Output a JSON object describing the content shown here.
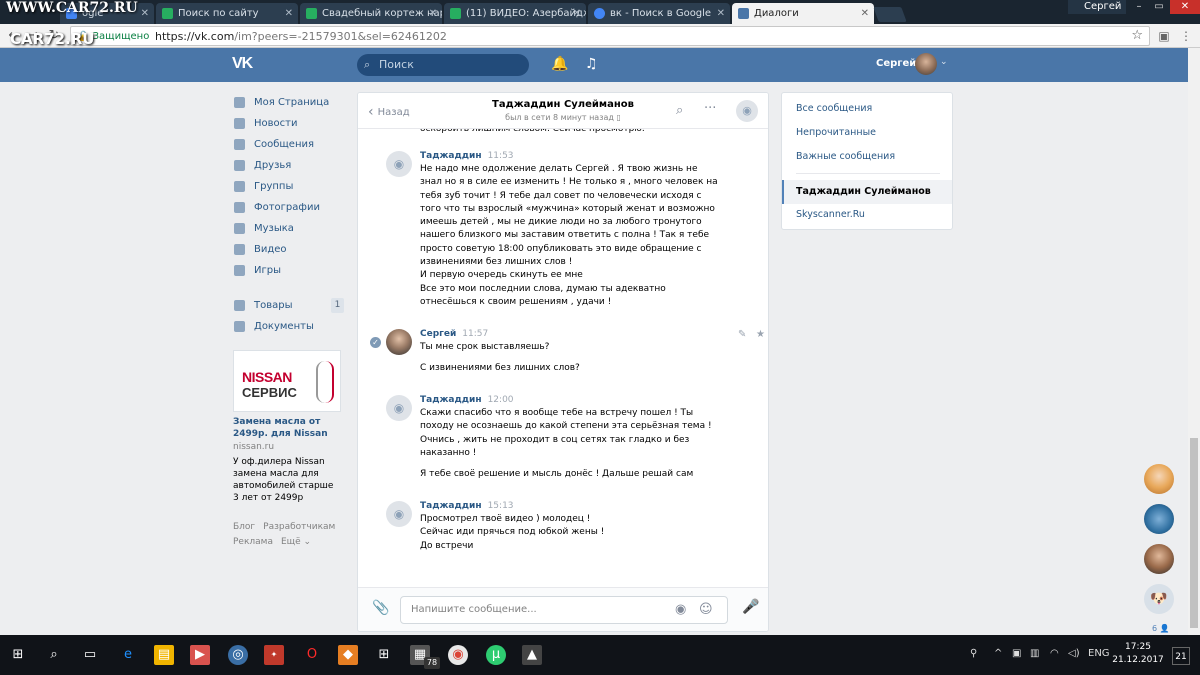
{
  "watermark": {
    "top": "WWW.CAR72.RU",
    "bottom": "CAR72.RU"
  },
  "browser": {
    "tabs": [
      {
        "label": "ogle",
        "color": "#4285f4"
      },
      {
        "label": "Поиск по сайту",
        "color": "#27ae60"
      },
      {
        "label": "Свадебный кортеж нар",
        "color": "#27ae60"
      },
      {
        "label": "(11) ВИДЕО: Азербайдж",
        "color": "#27ae60"
      },
      {
        "label": "вк - Поиск в Google",
        "color": "#4285f4"
      },
      {
        "label": "Диалоги",
        "color": "#4a76a8"
      }
    ],
    "profile_name": "Сергей",
    "secure_label": "Защищено",
    "url_host": "https://vk.com",
    "url_path": "/im?peers=-21579301&sel=62461202",
    "back_icon": "arrow-left-icon",
    "forward_icon": "arrow-right-icon",
    "reload_icon": "reload-icon"
  },
  "vk_header": {
    "logo": "VK",
    "search_placeholder": "Поиск",
    "user_name": "Сергей",
    "bell_icon": "🔔",
    "music_icon": "♫"
  },
  "left_nav": {
    "items": [
      {
        "label": "Моя Страница"
      },
      {
        "label": "Новости"
      },
      {
        "label": "Сообщения"
      },
      {
        "label": "Друзья"
      },
      {
        "label": "Группы"
      },
      {
        "label": "Фотографии"
      },
      {
        "label": "Музыка"
      },
      {
        "label": "Видео"
      },
      {
        "label": "Игры"
      }
    ],
    "extra": [
      {
        "label": "Товары",
        "badge": "1"
      },
      {
        "label": "Документы"
      }
    ]
  },
  "ad": {
    "brand_line1": "NISSAN",
    "brand_line2": "СЕРВИС",
    "title": "Замена масла от 2499р. для Nissan",
    "domain": "nissan.ru",
    "text": "У оф.дилера Nissan замена масла для автомобилей старше 3 лет от 2499р"
  },
  "footer": {
    "links": [
      "Блог",
      "Разработчикам",
      "Реклама",
      "Ещё ⌄"
    ]
  },
  "chat": {
    "back_label": "Назад",
    "peer_name": "Таджаддин Сулейманов",
    "peer_status": "был в сети 8 минут назад",
    "cut_text": "оскорбить лишним словом. Сейчас просмотрю.",
    "messages": [
      {
        "author": "Таджаддин",
        "time": "11:53",
        "lines": [
          "Не надо мне одолжение делать Сергей . Я твою жизнь не знал но я в силе ее изменить ! Не только я , много человек на тебя зуб точит ! Я тебе дал совет по человечески исходя с того что ты взрослый «мужчина» который женат и возможно имеешь детей , мы не дикие люди но за любого тронутого нашего близкого мы заставим ответить с полна ! Так я тебе просто советую 18:00 опубликовать это виде обращение с извинениями без лишних слов !",
          "И первую очередь скинуть ее мне",
          "Все это мои последнии слова, думаю ты адекватно отнесёшься к своим решениям , удачи !"
        ]
      },
      {
        "author": "Сергей",
        "time": "11:57",
        "lines": [
          "Ты мне срок выставляешь?"
        ],
        "extra": [
          "С извинениями без лишних слов?"
        ]
      },
      {
        "author": "Таджаддин",
        "time": "12:00",
        "lines": [
          "Скажи спасибо что я вообще тебе на встречу пошел ! Ты походу не осознаешь до какой степени эта серьёзная тема ! Очнись , жить не проходит в соц сетях так гладко и без наказанно !"
        ],
        "extra": [
          "Я тебе своё решение и мысль донёс ! Дальше решай сам"
        ]
      },
      {
        "author": "Таджаддин",
        "time": "15:13",
        "lines": [
          "Просмотрел твоё видео ) молодец !",
          "Сейчас иди прячься под юбкой жены !",
          "До встречи"
        ]
      }
    ],
    "composer_placeholder": "Напишите сообщение..."
  },
  "right_menu": {
    "items": [
      "Все сообщения",
      "Непрочитанные",
      "Важные сообщения"
    ],
    "active": "Таджаддин Сулейманов",
    "other": "Skyscanner.Ru"
  },
  "dock": {
    "count": "6 👤"
  },
  "taskbar": {
    "badge": "78",
    "lang": "ENG",
    "time": "17:25",
    "date": "21.12.2017",
    "notif": "21"
  }
}
